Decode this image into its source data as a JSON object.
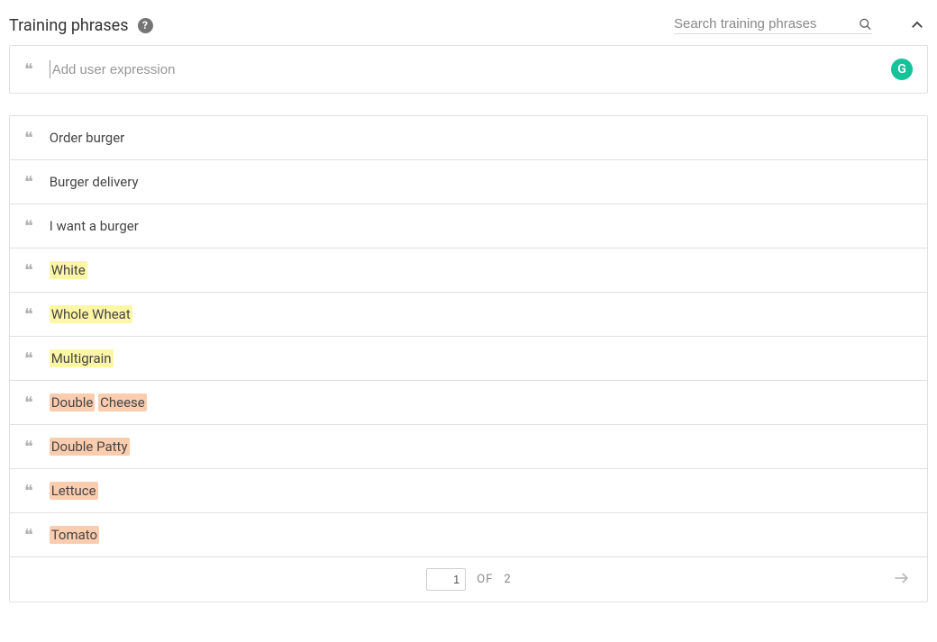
{
  "header": {
    "title": "Training phrases",
    "search_placeholder": "Search training phrases"
  },
  "add_row": {
    "placeholder": "Add user expression",
    "badge": "G"
  },
  "phrases": [
    {
      "segments": [
        {
          "text": "Order burger",
          "hl": null
        }
      ]
    },
    {
      "segments": [
        {
          "text": "Burger delivery",
          "hl": null
        }
      ]
    },
    {
      "segments": [
        {
          "text": "I want a burger",
          "hl": null
        }
      ]
    },
    {
      "segments": [
        {
          "text": "White",
          "hl": "yellow"
        }
      ]
    },
    {
      "segments": [
        {
          "text": "Whole Wheat",
          "hl": "yellow"
        }
      ]
    },
    {
      "segments": [
        {
          "text": "Multigrain",
          "hl": "yellow"
        }
      ]
    },
    {
      "segments": [
        {
          "text": "Double",
          "hl": "orange"
        },
        {
          "text": " ",
          "hl": null
        },
        {
          "text": "Cheese",
          "hl": "orange"
        }
      ]
    },
    {
      "segments": [
        {
          "text": "Double Patty",
          "hl": "orange"
        }
      ]
    },
    {
      "segments": [
        {
          "text": "Lettuce",
          "hl": "orange"
        }
      ]
    },
    {
      "segments": [
        {
          "text": "Tomato",
          "hl": "orange"
        }
      ]
    }
  ],
  "pagination": {
    "current": "1",
    "of_label": "OF",
    "total": "2"
  },
  "colors": {
    "accent": "#15c39a",
    "highlight_yellow": "#fdf6a5",
    "highlight_orange": "#fcccae"
  }
}
